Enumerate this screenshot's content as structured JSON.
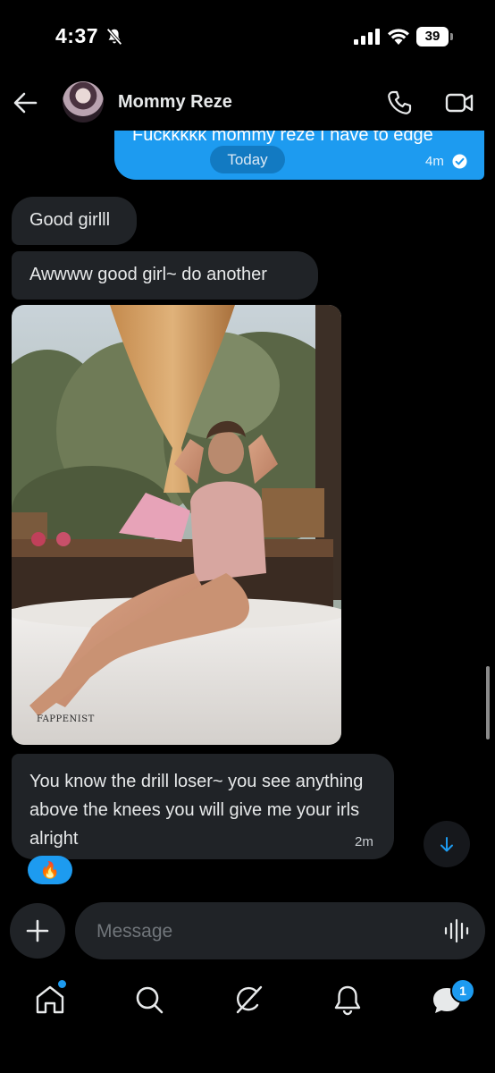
{
  "status_bar": {
    "time": "4:37",
    "battery": "39"
  },
  "header": {
    "contact_name": "Mommy Reze"
  },
  "messages": {
    "sent": {
      "text": "Fuckkkkk mommy reze I have to edge",
      "date_pill": "Today",
      "time": "4m"
    },
    "received": [
      {
        "text": "Good girlll"
      },
      {
        "text": "Awwww good girl~ do another"
      },
      {
        "text": "You know the drill loser~ you see anything above the knees you will give me your irls alright",
        "time": "2m",
        "reaction": "🔥"
      }
    ],
    "image": {
      "watermark": "FAPPENIST"
    }
  },
  "composer": {
    "placeholder": "Message"
  },
  "nav": {
    "messages_badge": "1"
  },
  "colors": {
    "accent": "#1d9bf0",
    "bubble_received": "#202327",
    "background": "#000000"
  }
}
